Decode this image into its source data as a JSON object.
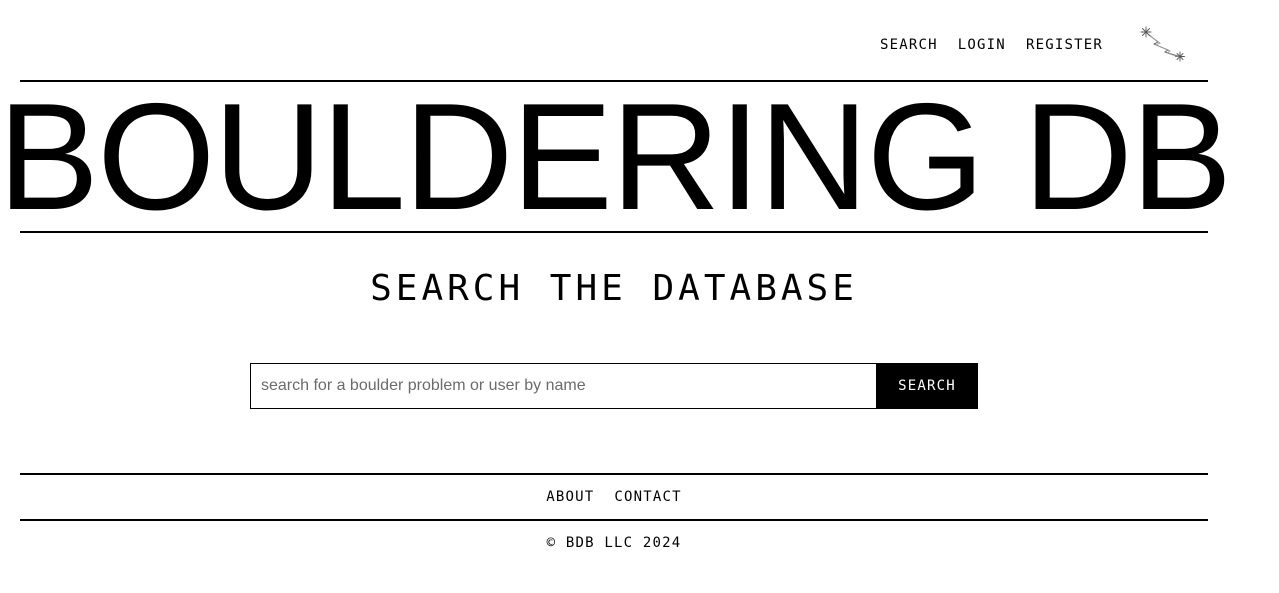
{
  "nav": {
    "search_label": "SEARCH",
    "login_label": "LOGIN",
    "register_label": "REGISTER",
    "logo_icon": "star-constellation-icon"
  },
  "brand": {
    "title": "BOULDERING DB"
  },
  "main": {
    "heading": "SEARCH THE DATABASE",
    "search": {
      "placeholder": "search for a boulder problem or user by name",
      "value": "",
      "button_label": "SEARCH"
    }
  },
  "footer": {
    "about_label": "ABOUT",
    "contact_label": "CONTACT",
    "copyright": "© BDB LLC 2024"
  },
  "colors": {
    "primary": "#000000",
    "background": "#ffffff",
    "placeholder": "#6b6b6b"
  }
}
